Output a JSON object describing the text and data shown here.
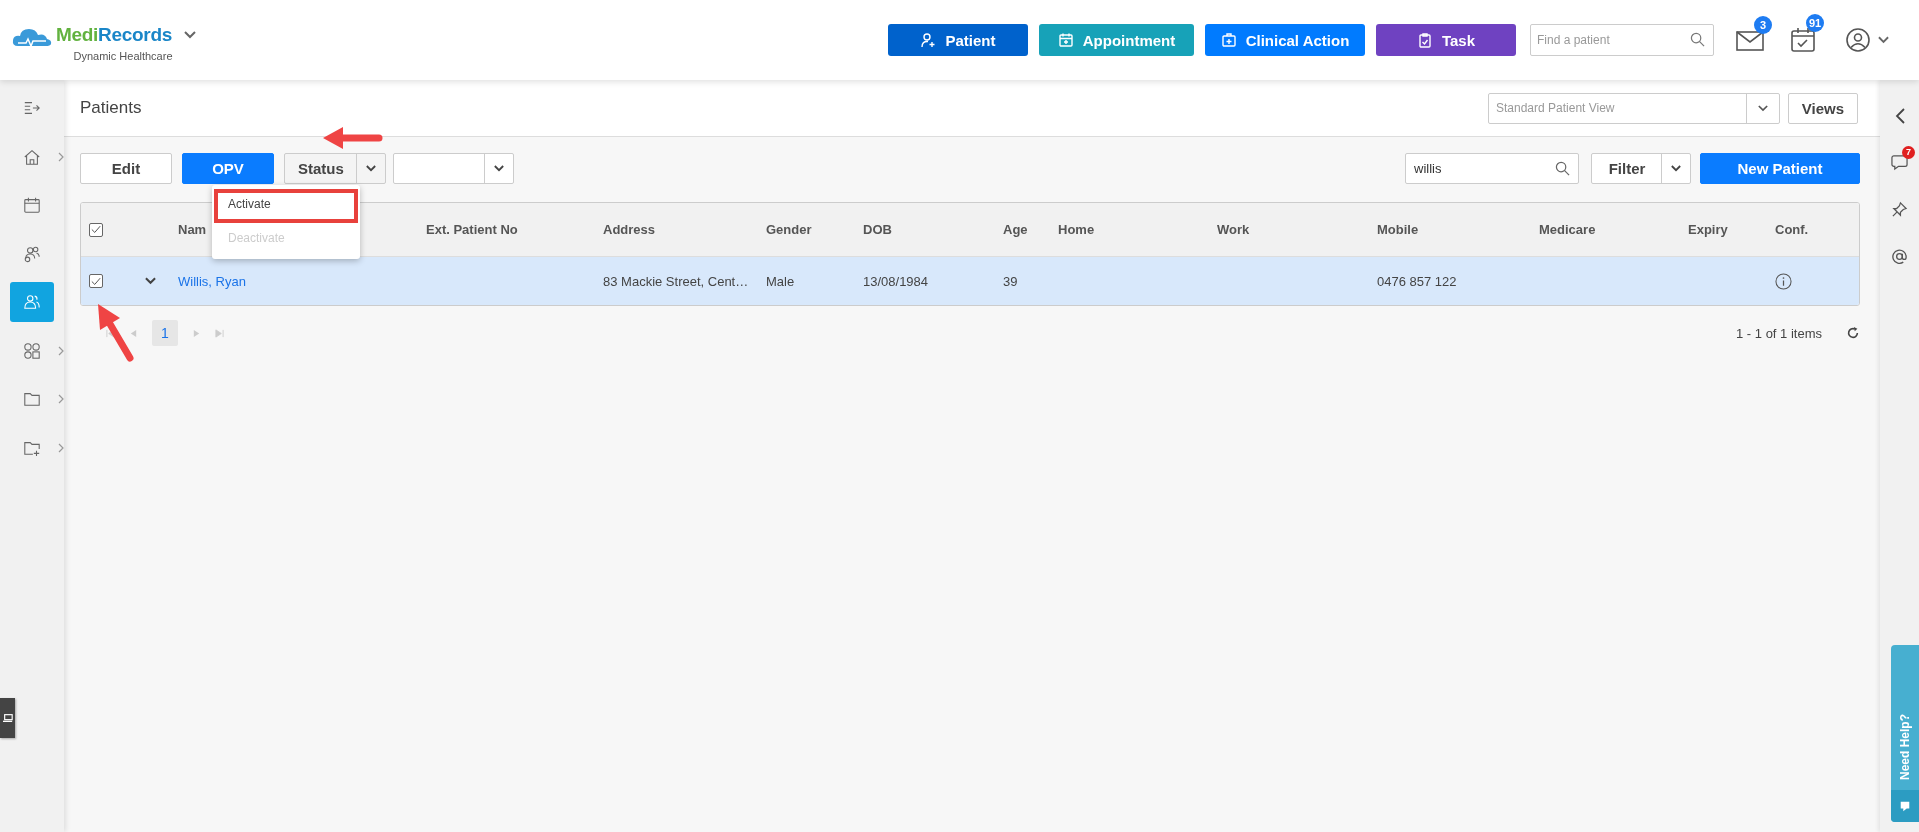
{
  "header": {
    "brand_first": "Medi",
    "brand_second": "Records",
    "subtitle": "Dynamic Healthcare",
    "actions": [
      {
        "label": "Patient",
        "kind": "person-add",
        "color": "#0062cc"
      },
      {
        "label": "Appointment",
        "kind": "calendar",
        "color": "#17a2b8"
      },
      {
        "label": "Clinical Action",
        "kind": "kit",
        "color": "#007bff"
      },
      {
        "label": "Task",
        "kind": "clipboard",
        "color": "#6f42c1"
      }
    ],
    "search": {
      "placeholder": "Find a patient"
    },
    "mail_badge": "3",
    "calendar_badge": "91"
  },
  "sidebar": {
    "items": [
      {
        "kind": "expand",
        "expandable": false,
        "selected": false
      },
      {
        "kind": "home",
        "expandable": true,
        "selected": false
      },
      {
        "kind": "calendar",
        "expandable": false,
        "selected": false
      },
      {
        "kind": "group",
        "expandable": false,
        "selected": false
      },
      {
        "kind": "patients",
        "expandable": false,
        "selected": true
      },
      {
        "kind": "modules",
        "expandable": true,
        "selected": false
      },
      {
        "kind": "folder",
        "expandable": true,
        "selected": false
      },
      {
        "kind": "folder-add",
        "expandable": true,
        "selected": false
      }
    ]
  },
  "page": {
    "title": "Patients",
    "view_select": "Standard Patient View",
    "views_button": "Views"
  },
  "toolbar": {
    "edit": "Edit",
    "opv": "OPV",
    "status": "Status",
    "search_value": "willis",
    "filter": "Filter",
    "new_patient": "New Patient"
  },
  "status_menu": {
    "items": [
      {
        "label": "Activate",
        "disabled": false,
        "highlighted": true
      },
      {
        "label": "Deactivate",
        "disabled": true,
        "highlighted": false
      }
    ]
  },
  "table": {
    "all_checked": true,
    "columns": [
      "Nam",
      "Ext. Patient No",
      "Address",
      "Gender",
      "DOB",
      "Age",
      "Home",
      "Work",
      "Mobile",
      "Medicare",
      "Expiry",
      "Conf."
    ],
    "rows": [
      {
        "selected": true,
        "expanded": false,
        "cells": [
          "Willis, Ryan",
          null,
          "83 Mackie Street, Cent…",
          "Male",
          "13/08/1984",
          "39",
          null,
          null,
          "0476 857 122",
          null,
          null
        ],
        "conf_info": true
      }
    ]
  },
  "pagination": {
    "page": "1",
    "summary": "1 - 1 of 1 items"
  },
  "right_rail": {
    "chat_badge": "7",
    "help": "Need Help?"
  }
}
